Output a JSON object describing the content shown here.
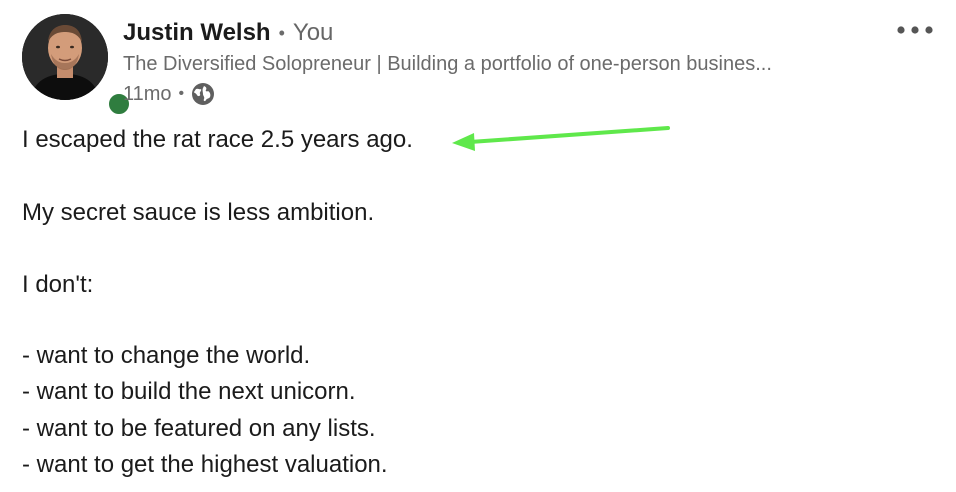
{
  "author": {
    "name": "Justin Welsh",
    "separator": "•",
    "relation": "You",
    "headline": "The Diversified Solopreneur | Building a portfolio of one-person busines...",
    "time_ago": "11mo",
    "meta_separator": "•",
    "visibility_icon": "globe-icon",
    "online_status_color": "#2f7d3f"
  },
  "menu": {
    "icon": "more-horizontal-icon"
  },
  "post": {
    "lines": [
      "I escaped the rat race 2.5 years ago.",
      "My secret sauce is less ambition.",
      "I don't:",
      "- want to change the world.",
      "- want to build the next unicorn.",
      "- want to be featured on any lists.",
      "- want to get the highest valuation."
    ],
    "annotation_arrow_color": "#5fe84b"
  }
}
